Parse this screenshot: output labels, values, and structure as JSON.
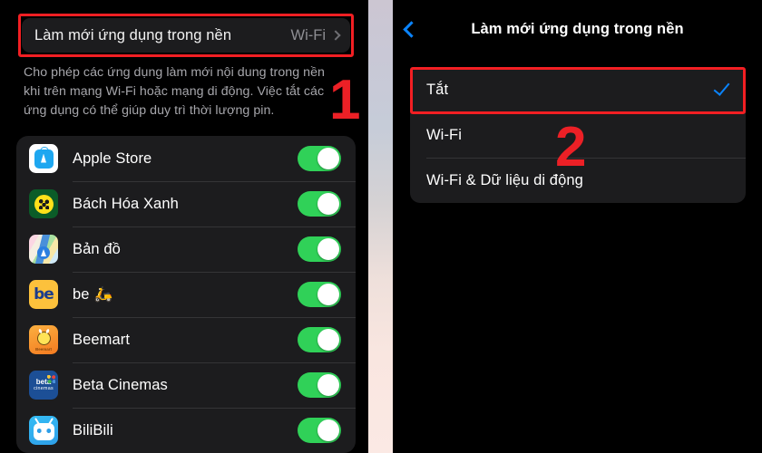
{
  "left_panel": {
    "setting_row": {
      "label": "Làm mới ứng dụng trong nền",
      "value": "Wi-Fi",
      "chevron": "chevron-right-icon"
    },
    "description": "Cho phép các ứng dụng làm mới nội dung trong nền khi trên mạng Wi-Fi hoặc mạng di động. Việc tắt các ứng dụng có thể giúp duy trì thời lượng pin.",
    "apps": [
      {
        "name": "Apple Store",
        "icon": "apple-store-icon",
        "toggle": "on"
      },
      {
        "name": "Bách Hóa Xanh",
        "icon": "bach-hoa-xanh-icon",
        "toggle": "on"
      },
      {
        "name": "Bản đồ",
        "icon": "maps-icon",
        "toggle": "on"
      },
      {
        "name": "be",
        "suffix": "🛵",
        "icon": "be-icon",
        "toggle": "on"
      },
      {
        "name": "Beemart",
        "icon": "beemart-icon",
        "toggle": "on"
      },
      {
        "name": "Beta Cinemas",
        "icon": "beta-cinemas-icon",
        "toggle": "on"
      },
      {
        "name": "BiliBili",
        "icon": "bilibili-icon",
        "toggle": "on"
      }
    ]
  },
  "right_panel": {
    "nav": {
      "back": "back-chevron-icon",
      "title": "Làm mới ứng dụng trong nền"
    },
    "options": [
      {
        "label": "Tắt",
        "selected": true
      },
      {
        "label": "Wi-Fi",
        "selected": false
      },
      {
        "label": "Wi-Fi & Dữ liệu di động",
        "selected": false
      }
    ]
  },
  "annotations": {
    "marker_1": "1",
    "marker_2": "2",
    "highlight_color": "#f21f23",
    "marker_color": "#ec2026"
  },
  "icon_labels": {
    "be": "be",
    "beemart": "Beemart",
    "beta_1": "beta",
    "beta_2": "cinemas"
  }
}
